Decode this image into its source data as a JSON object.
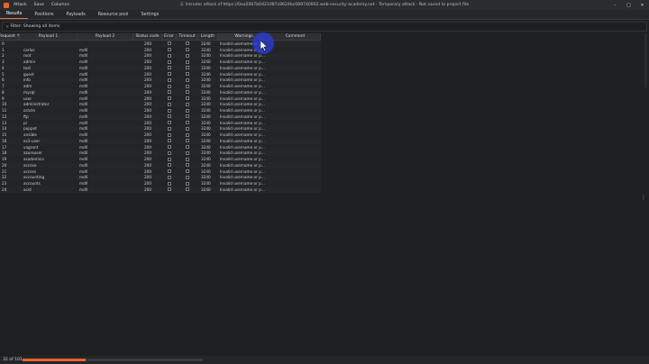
{
  "menu": {
    "attack": "Attack",
    "save": "Save",
    "columns": "Columns"
  },
  "window_title": "2. Intruder attack of https://0aa5007b0421087c8624bc089740002.web-security-academy.net - Temporary attack - Not saved to project file",
  "window_buttons": [
    "–",
    "□",
    "✕"
  ],
  "tabs": [
    {
      "label": "Results",
      "active": true
    },
    {
      "label": "Positions",
      "active": false
    },
    {
      "label": "Payloads",
      "active": false
    },
    {
      "label": "Resource pool",
      "active": false
    },
    {
      "label": "Settings",
      "active": false
    }
  ],
  "filter": {
    "text": "Filter: Showing all items"
  },
  "columns": [
    "Request ↑",
    "Payload 1",
    "Payload 2",
    "Status code",
    "Error",
    "Timeout",
    "Length",
    "Warnings",
    "Comment"
  ],
  "rows": [
    [
      "0",
      "",
      "",
      "200",
      "",
      "",
      "3240",
      "Invalid username or p..."
    ],
    [
      "1",
      "carlos",
      "mdll",
      "200",
      "",
      "",
      "3240",
      "Invalid username or p..."
    ],
    [
      "2",
      "root",
      "mdll",
      "200",
      "",
      "",
      "3240",
      "Invalid username or p..."
    ],
    [
      "3",
      "admin",
      "mdll",
      "200",
      "",
      "",
      "3240",
      "Invalid username or p..."
    ],
    [
      "4",
      "test",
      "mdll",
      "200",
      "",
      "",
      "3240",
      "Invalid username or p..."
    ],
    [
      "5",
      "guest",
      "mdll",
      "200",
      "",
      "",
      "3240",
      "Invalid username or p..."
    ],
    [
      "6",
      "info",
      "mdll",
      "200",
      "",
      "",
      "3240",
      "Invalid username or p..."
    ],
    [
      "7",
      "adm",
      "mdll",
      "200",
      "",
      "",
      "3240",
      "Invalid username or p..."
    ],
    [
      "8",
      "mysql",
      "mdll",
      "200",
      "",
      "",
      "3240",
      "Invalid username or p..."
    ],
    [
      "9",
      "user",
      "mdll",
      "200",
      "",
      "",
      "3240",
      "Invalid username or p..."
    ],
    [
      "10",
      "administrator",
      "mdll",
      "200",
      "",
      "",
      "3240",
      "Invalid username or p..."
    ],
    [
      "11",
      "oracle",
      "mdll",
      "200",
      "",
      "",
      "3240",
      "Invalid username or p..."
    ],
    [
      "12",
      "ftp",
      "mdll",
      "200",
      "",
      "",
      "3240",
      "Invalid username or p..."
    ],
    [
      "13",
      "pi",
      "mdll",
      "200",
      "",
      "",
      "3240",
      "Invalid username or p..."
    ],
    [
      "14",
      "puppet",
      "mdll",
      "200",
      "",
      "",
      "3240",
      "Invalid username or p..."
    ],
    [
      "15",
      "ansible",
      "mdll",
      "200",
      "",
      "",
      "3240",
      "Invalid username or p..."
    ],
    [
      "16",
      "ec2-user",
      "mdll",
      "200",
      "",
      "",
      "3240",
      "Invalid username or p..."
    ],
    [
      "17",
      "vagrant",
      "mdll",
      "200",
      "",
      "",
      "3240",
      "Invalid username or p..."
    ],
    [
      "18",
      "azureuser",
      "mdll",
      "200",
      "",
      "",
      "3240",
      "Invalid username or p..."
    ],
    [
      "19",
      "academico",
      "mdll",
      "200",
      "",
      "",
      "3240",
      "Invalid username or p..."
    ],
    [
      "20",
      "acceso",
      "mdll",
      "200",
      "",
      "",
      "3240",
      "Invalid username or p..."
    ],
    [
      "21",
      "access",
      "mdll",
      "200",
      "",
      "",
      "3240",
      "Invalid username or p..."
    ],
    [
      "22",
      "accounting",
      "mdll",
      "200",
      "",
      "",
      "3240",
      "Invalid username or p..."
    ],
    [
      "23",
      "accounts",
      "mdll",
      "200",
      "",
      "",
      "3240",
      "Invalid username or p..."
    ],
    [
      "24",
      "acid",
      "mdll",
      "200",
      "",
      "",
      "3240",
      "Invalid username or p..."
    ]
  ],
  "status": {
    "text": "32 of 101",
    "progress_fraction": 0.35
  },
  "colors": {
    "accent": "#e8642c",
    "cursor_highlight": "#2a3cdc"
  }
}
